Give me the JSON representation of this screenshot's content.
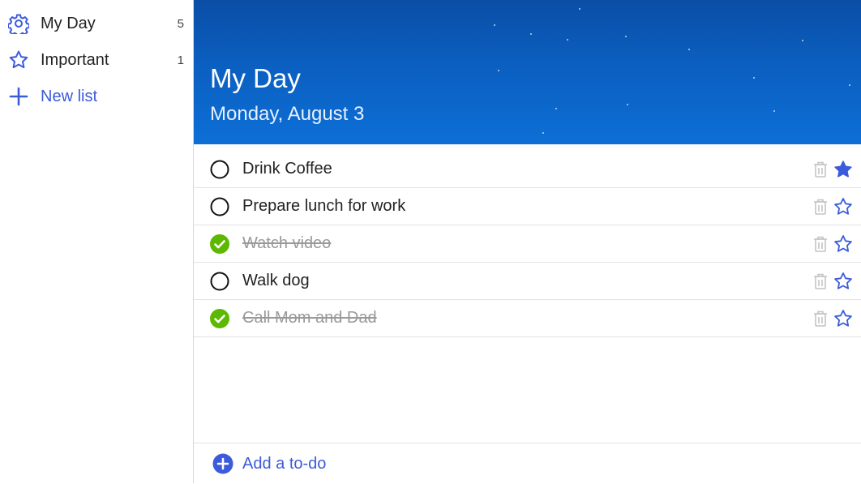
{
  "sidebar": {
    "items": [
      {
        "label": "My Day",
        "count": "5",
        "icon": "gear-icon"
      },
      {
        "label": "Important",
        "count": "1",
        "icon": "star-outline-icon"
      },
      {
        "label": "New list",
        "icon": "plus-icon"
      }
    ]
  },
  "header": {
    "title": "My Day",
    "date": "Monday, August 3"
  },
  "tasks": [
    {
      "text": "Drink Coffee",
      "completed": false,
      "important": true
    },
    {
      "text": "Prepare lunch for work",
      "completed": false,
      "important": false
    },
    {
      "text": "Watch video",
      "completed": true,
      "important": false
    },
    {
      "text": "Walk dog",
      "completed": false,
      "important": false
    },
    {
      "text": "Call Mom and Dad",
      "completed": true,
      "important": false
    }
  ],
  "add_todo": {
    "label": "Add a to-do"
  },
  "colors": {
    "accent": "#3b5bdb",
    "complete_green": "#5cb800",
    "header_blue": "#0b5fc0",
    "trash_gray": "#c4c4c4"
  }
}
